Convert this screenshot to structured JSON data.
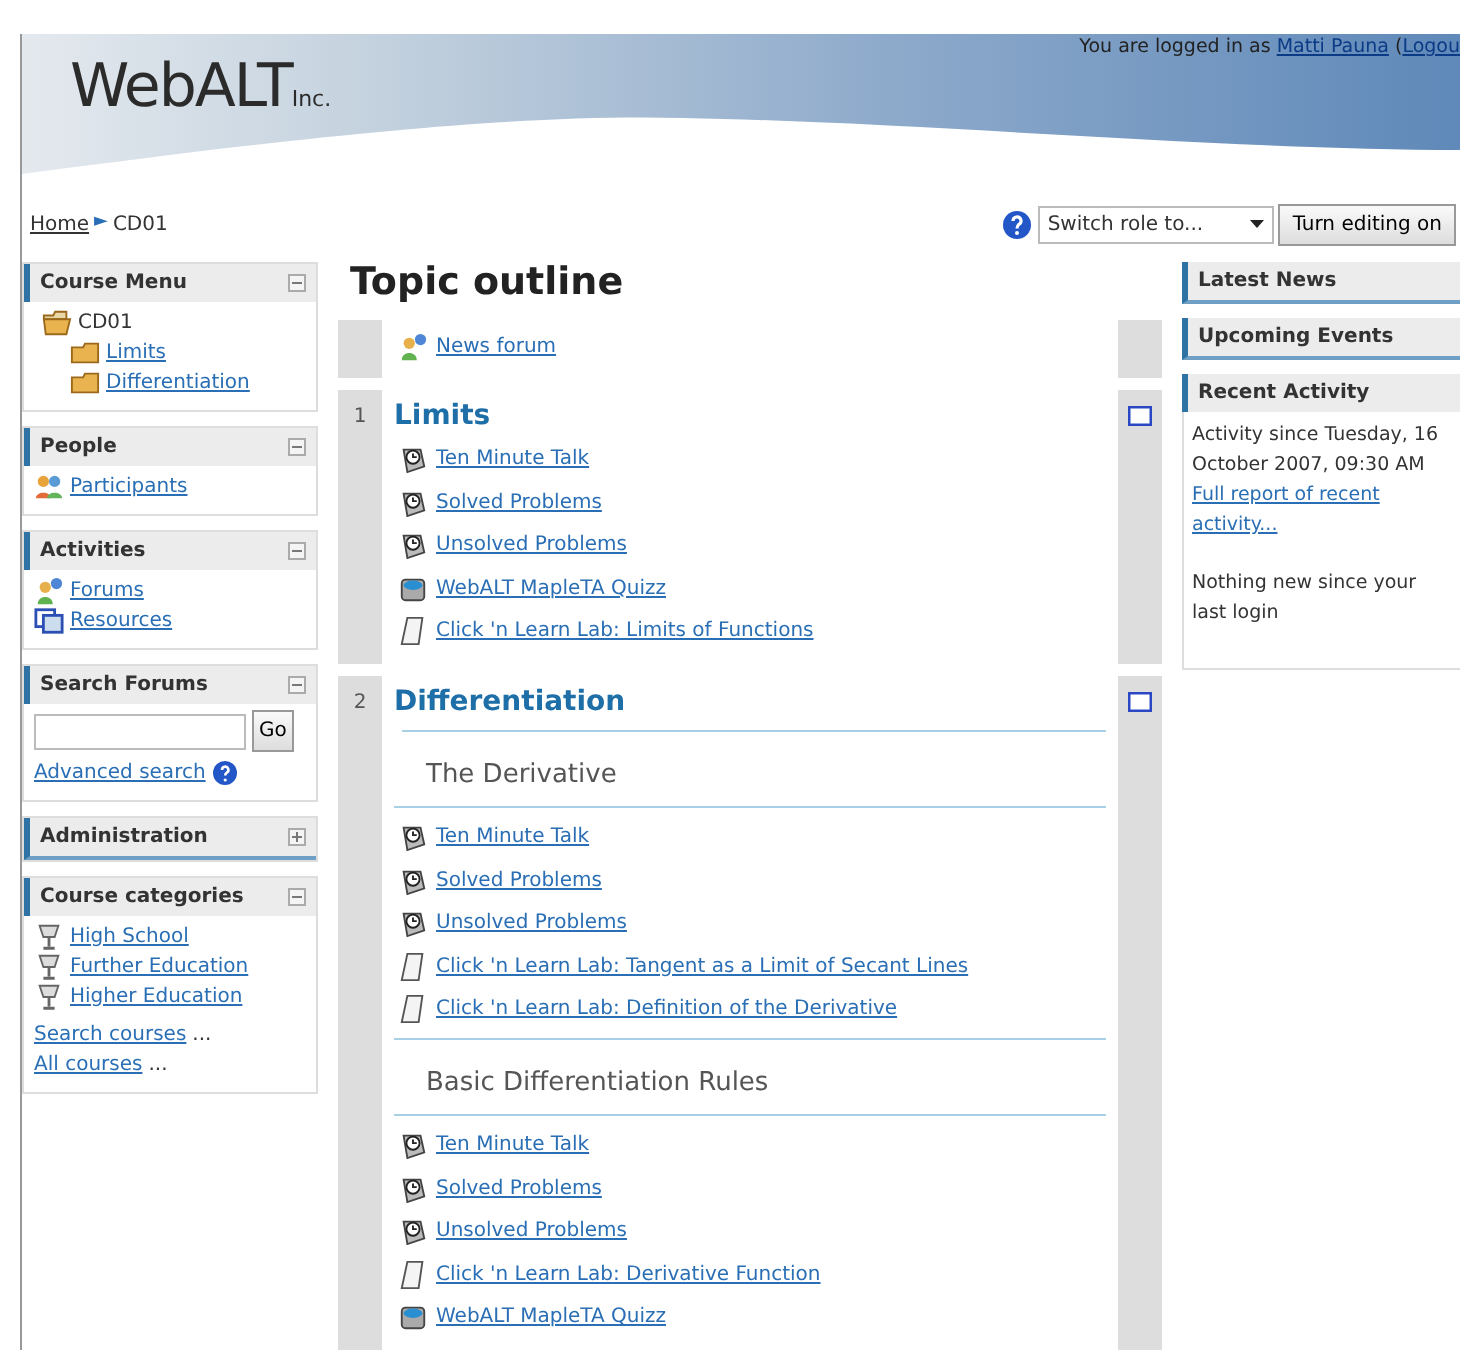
{
  "header": {
    "logo": "WebALT",
    "logo_suffix": "Inc.",
    "login_prefix": "You are logged in as",
    "user": "Matti Pauna",
    "paren": "(",
    "logout": "Logou"
  },
  "breadcrumb": {
    "items": [
      "Home",
      "CD01"
    ],
    "separator": "►"
  },
  "role_select": {
    "value": "Switch role to..."
  },
  "edit_button": "Turn editing on",
  "left_blocks": [
    {
      "kind": "tree",
      "title": "Course Menu",
      "expanded": true,
      "items": [
        {
          "label": "CD01",
          "children": [
            {
              "label": "Limits"
            },
            {
              "label": "Differentiation"
            }
          ]
        }
      ]
    },
    {
      "kind": "links",
      "title": "People",
      "expanded": true,
      "items": [
        {
          "kind": "people",
          "label": "Participants"
        }
      ]
    },
    {
      "kind": "links",
      "title": "Activities",
      "expanded": true,
      "items": [
        {
          "kind": "forum",
          "label": "Forums"
        },
        {
          "kind": "resource",
          "label": "Resources"
        }
      ]
    },
    {
      "kind": "search",
      "title": "Search Forums",
      "expanded": true,
      "button": "Go",
      "link": "Advanced search"
    },
    {
      "kind": "empty",
      "title": "Administration",
      "expanded": false
    },
    {
      "kind": "links",
      "title": "Course categories",
      "expanded": true,
      "items": [
        {
          "kind": "category",
          "label": "High School"
        },
        {
          "kind": "category",
          "label": "Further Education"
        },
        {
          "kind": "category",
          "label": "Higher Education"
        }
      ],
      "extra": [
        {
          "label": "Search courses",
          "suffix": "..."
        },
        {
          "label": "All courses",
          "suffix": "..."
        }
      ]
    }
  ],
  "main": {
    "title": "Topic outline",
    "sections": [
      {
        "items": [
          {
            "kind": "forum",
            "label": "News forum"
          }
        ]
      },
      {
        "number": "1",
        "title": "Limits",
        "highlight_toggle": true,
        "items": [
          {
            "kind": "clock",
            "label": "Ten Minute Talk"
          },
          {
            "kind": "clock",
            "label": "Solved Problems"
          },
          {
            "kind": "clock",
            "label": "Unsolved Problems"
          },
          {
            "kind": "quiz",
            "label": "WebALT MapleTA Quizz"
          },
          {
            "kind": "page",
            "label": "Click 'n Learn Lab: Limits of Functions"
          }
        ]
      },
      {
        "number": "2",
        "title": "Differentiation",
        "highlight_toggle": true,
        "items": [
          {
            "kind": "subheading",
            "label": "The Derivative"
          },
          {
            "kind": "clock",
            "label": "Ten Minute Talk"
          },
          {
            "kind": "clock",
            "label": "Solved Problems"
          },
          {
            "kind": "clock",
            "label": "Unsolved Problems"
          },
          {
            "kind": "page",
            "label": "Click 'n Learn Lab: Tangent as a Limit of Secant Lines"
          },
          {
            "kind": "page",
            "label": "Click 'n Learn Lab: Definition of the Derivative"
          },
          {
            "kind": "subheading",
            "label": "Basic Differentiation Rules"
          },
          {
            "kind": "clock",
            "label": "Ten Minute Talk"
          },
          {
            "kind": "clock",
            "label": "Solved Problems"
          },
          {
            "kind": "clock",
            "label": "Unsolved Problems"
          },
          {
            "kind": "page",
            "label": "Click 'n Learn Lab: Derivative Function"
          },
          {
            "kind": "quiz",
            "label": "WebALT MapleTA Quizz"
          }
        ]
      }
    ]
  },
  "right_blocks": [
    {
      "title": "Latest News"
    },
    {
      "title": "Upcoming Events"
    },
    {
      "title": "Recent Activity",
      "content": [
        {
          "kind": "text",
          "text": "Activity since Tuesday, 16 October 2007, 09:30 AM"
        },
        {
          "kind": "link",
          "text": "Full report of recent activity..."
        },
        {
          "kind": "text",
          "text": "Nothing new since your last login"
        }
      ]
    }
  ]
}
